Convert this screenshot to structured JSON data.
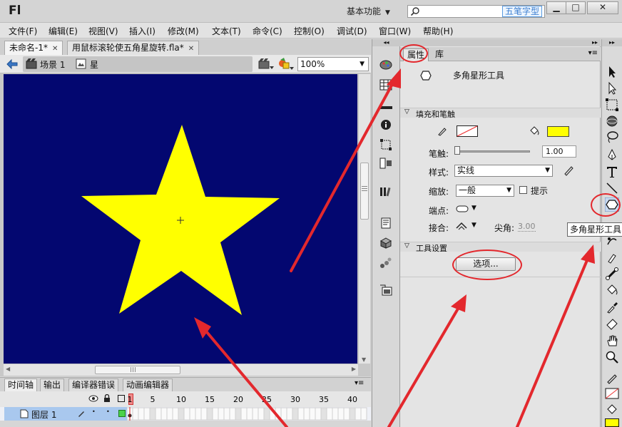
{
  "app": {
    "logo": "Fl",
    "workspace_label": "基本功能",
    "search_placeholder": "",
    "watermark": "五笔字型",
    "window_buttons": [
      "▁",
      "□",
      "✕"
    ]
  },
  "menu": [
    "文件(F)",
    "编辑(E)",
    "视图(V)",
    "插入(I)",
    "修改(M)",
    "文本(T)",
    "命令(C)",
    "控制(O)",
    "调试(D)",
    "窗口(W)",
    "帮助(H)"
  ],
  "doc_tabs": [
    {
      "label": "未命名-1*",
      "active": true
    },
    {
      "label": "用鼠标滚轮使五角星旋转.fla*",
      "active": false
    }
  ],
  "edit_bar": {
    "scene": "场景 1",
    "symbol": "星",
    "zoom": "100%"
  },
  "stage": {
    "background": "#030770",
    "star_color": "#ffff00"
  },
  "timeline": {
    "tabs": [
      "时间轴",
      "输出",
      "编译器错误",
      "动画编辑器"
    ],
    "frame_numbers": [
      "1",
      "5",
      "10",
      "15",
      "20",
      "25",
      "30",
      "35",
      "40"
    ],
    "layer_name": "图层 1"
  },
  "properties": {
    "tabs": [
      "属性",
      "库"
    ],
    "tool_name": "多角星形工具",
    "section_fill_stroke": "填充和笔触",
    "stroke_label": "笔触:",
    "stroke_value": "1.00",
    "style_label": "样式:",
    "style_value": "实线",
    "scale_label": "缩放:",
    "scale_value": "一般",
    "hint_label": "提示",
    "cap_label": "端点:",
    "join_label": "接合:",
    "miter_label": "尖角:",
    "miter_value": "3.00",
    "section_tool_settings": "工具设置",
    "options_button": "选项...",
    "fill_color": "#ffff00"
  },
  "tooltip": "多角星形工具",
  "colors": {
    "annotation_red": "#e3282d",
    "highlight_blue": "#a9c8ee"
  }
}
